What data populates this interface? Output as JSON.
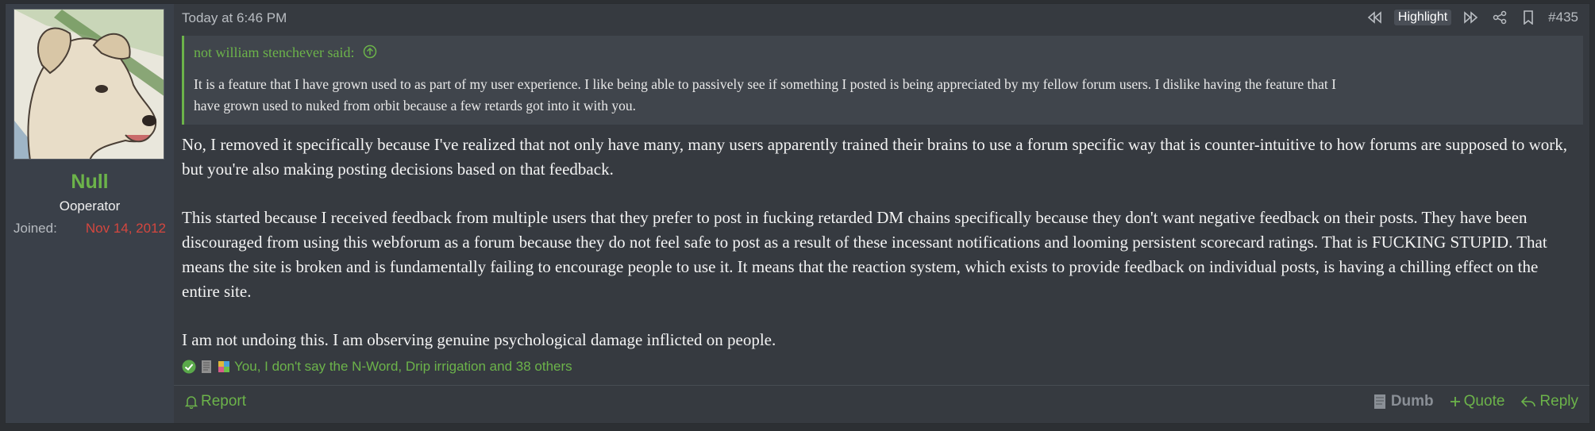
{
  "user": {
    "name": "Null",
    "title": "Ooperator",
    "joined_label": "Joined:",
    "joined_value": "Nov 14, 2012",
    "avatar_icon": "dog-avatar"
  },
  "post": {
    "timestamp": "Today at 6:46 PM",
    "highlight_label": "Highlight",
    "post_number": "#435",
    "quote": {
      "author_line": "not william stenchever said:",
      "lines": [
        "It is a feature that I have grown used to as part of my user experience. I like being able to passively see if something I posted is being appreciated by my fellow forum users. I dislike having the feature that I",
        "have grown used to nuked from orbit because a few retards got into it with you."
      ]
    },
    "paragraphs": [
      "No, I removed it specifically because I've realized that not only have many, many users apparently trained their brains to use a forum specific way that is counter-intuitive to how forums are supposed to work, but you're also making posting decisions based on that feedback.",
      "This started because I received feedback from multiple users that they prefer to post in fucking retarded DM chains specifically because they don't want negative feedback on their posts. They have been discouraged from using this webforum as a forum because they do not feel safe to post as a result of these incessant notifications and looming persistent scorecard ratings. That is FUCKING STUPID. That means the site is broken and is fundamentally failing to encourage people to use it. It means that the reaction system, which exists to provide feedback on individual posts, is having a chilling effect on the entire site.",
      "I am not undoing this. I am observing genuine psychological damage inflicted on people."
    ],
    "reactions_text": "You, I don't say the N-Word, Drip irrigation and 38 others"
  },
  "footer": {
    "report_label": "Report",
    "dumb_label": "Dumb",
    "quote_label": "Quote",
    "reply_label": "Reply"
  },
  "colors": {
    "accent": "#6cb34a",
    "joined": "#d4473f",
    "background": "#363a40"
  }
}
